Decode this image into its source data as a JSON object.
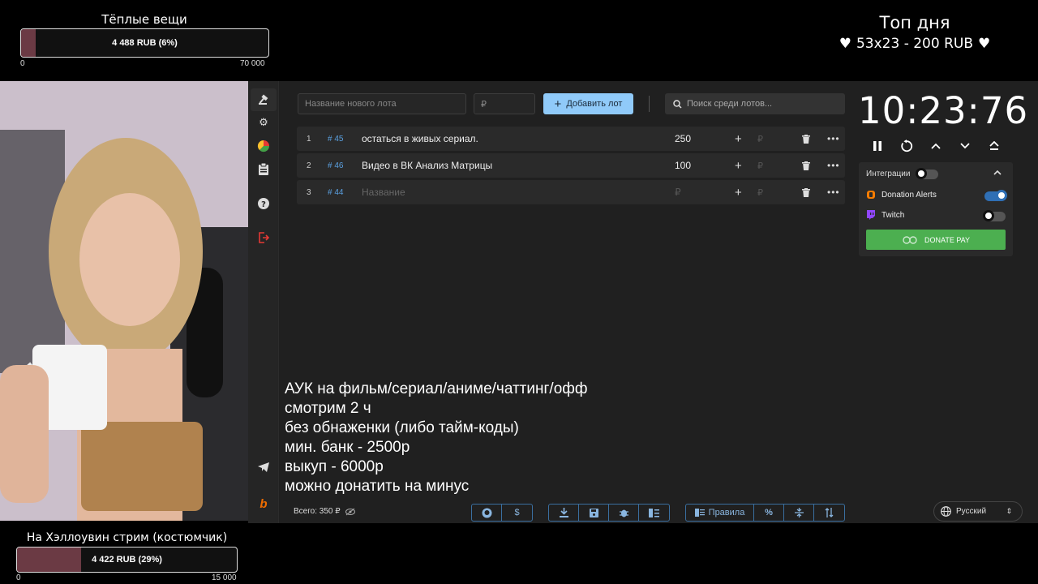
{
  "goal_top": {
    "title": "Тёплые вещи",
    "amount": "4 488 RUB (6%)",
    "progress": 0.06,
    "min": "0",
    "max": "70 000"
  },
  "top_day": {
    "title": "Топ дня",
    "line": "53x23 - 200 RUB"
  },
  "goal_bottom": {
    "title": "На Хэллоувин стрим (костюмчик)",
    "amount": "4 422 RUB (29%)",
    "progress": 0.29,
    "min": "0",
    "max": "15 000"
  },
  "toolbar": {
    "lot_name_placeholder": "Название нового лота",
    "amount_placeholder": "₽",
    "add_label": "Добавить лот",
    "search_placeholder": "Поиск среди лотов..."
  },
  "lots": [
    {
      "index": "1",
      "id": "# 45",
      "name": "остаться в живых сериал.",
      "amount": "250",
      "rub": "₽"
    },
    {
      "index": "2",
      "id": "# 46",
      "name": "Видео в ВК Анализ Матрицы",
      "amount": "100",
      "rub": "₽"
    },
    {
      "index": "3",
      "id": "# 44",
      "name": "Название",
      "amount": "₽",
      "rub": "₽"
    }
  ],
  "timer": "10:23:76",
  "integrations": {
    "title": "Интеграции",
    "items": [
      {
        "label": "Donation Alerts",
        "enabled": true
      },
      {
        "label": "Twitch",
        "enabled": false
      }
    ],
    "donatepay_label": "DONATE PAY"
  },
  "rules": [
    "АУК на фильм/сериал/аниме/чаттинг/офф",
    "смотрим 2 ч",
    "без обнаженки (либо тайм-коды)",
    "мин. банк - 2500р",
    "выкуп - 6000р",
    "можно донатить на минус"
  ],
  "footer": {
    "total": "Всего: 350 ₽",
    "rules_label": "Правила",
    "language": "Русский"
  },
  "colors": {
    "accent": "#90caf9",
    "donatepay": "#4caf50",
    "goal_fill": "#6b3a44",
    "panel": "#202020"
  }
}
